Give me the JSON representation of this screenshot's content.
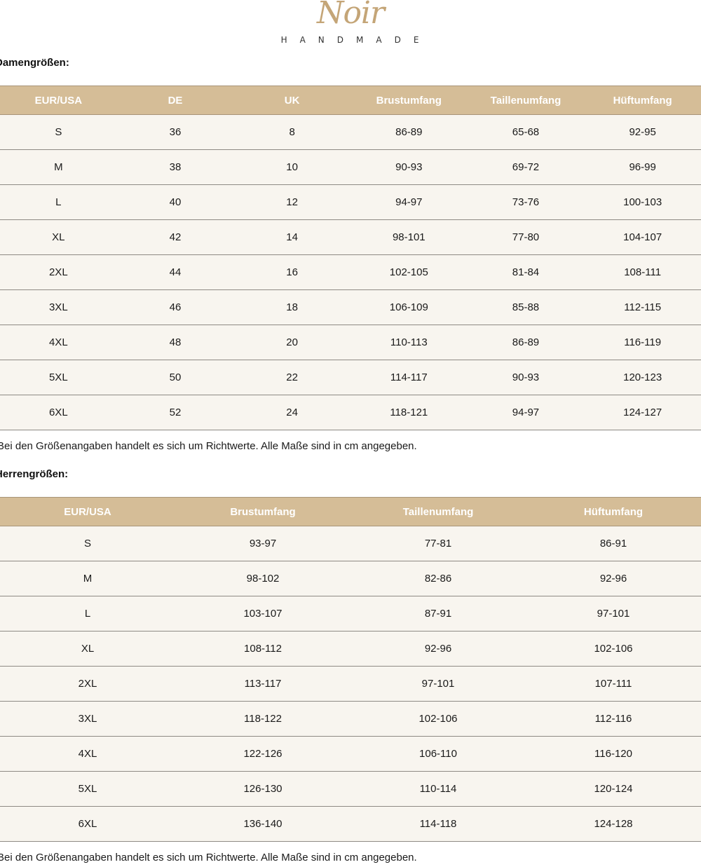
{
  "logo": {
    "script": "Noir",
    "sub": "HANDMADE"
  },
  "women": {
    "heading": "Damengrößen:",
    "columns": [
      "EUR/USA",
      "DE",
      "UK",
      "Brustumfang",
      "Taillenumfang",
      "Hüftumfang"
    ],
    "rows": [
      [
        "S",
        "36",
        "8",
        "86-89",
        "65-68",
        "92-95"
      ],
      [
        "M",
        "38",
        "10",
        "90-93",
        "69-72",
        "96-99"
      ],
      [
        "L",
        "40",
        "12",
        "94-97",
        "73-76",
        "100-103"
      ],
      [
        "XL",
        "42",
        "14",
        "98-101",
        "77-80",
        "104-107"
      ],
      [
        "2XL",
        "44",
        "16",
        "102-105",
        "81-84",
        "108-111"
      ],
      [
        "3XL",
        "46",
        "18",
        "106-109",
        "85-88",
        "112-115"
      ],
      [
        "4XL",
        "48",
        "20",
        "110-113",
        "86-89",
        "116-119"
      ],
      [
        "5XL",
        "50",
        "22",
        "114-117",
        "90-93",
        "120-123"
      ],
      [
        "6XL",
        "52",
        "24",
        "118-121",
        "94-97",
        "124-127"
      ]
    ],
    "note": "Bei den Größenangaben handelt es sich um Richtwerte. Alle Maße sind in cm angegeben."
  },
  "men": {
    "heading": "Herrengrößen:",
    "columns": [
      "EUR/USA",
      "Brustumfang",
      "Taillenumfang",
      "Hüftumfang"
    ],
    "rows": [
      [
        "S",
        "93-97",
        "77-81",
        "86-91"
      ],
      [
        "M",
        "98-102",
        "82-86",
        "92-96"
      ],
      [
        "L",
        "103-107",
        "87-91",
        "97-101"
      ],
      [
        "XL",
        "108-112",
        "92-96",
        "102-106"
      ],
      [
        "2XL",
        "113-117",
        "97-101",
        "107-111"
      ],
      [
        "3XL",
        "118-122",
        "102-106",
        "112-116"
      ],
      [
        "4XL",
        "122-126",
        "106-110",
        "116-120"
      ],
      [
        "5XL",
        "126-130",
        "110-114",
        "120-124"
      ],
      [
        "6XL",
        "136-140",
        "114-118",
        "124-128"
      ]
    ],
    "note": "Bei den Größenangaben handelt es sich um Richtwerte. Alle Maße sind in cm angegeben."
  },
  "colors": {
    "header_bg": "#d5bd97",
    "row_bg": "#f8f5ef",
    "logo_gold": "#c4a577"
  }
}
